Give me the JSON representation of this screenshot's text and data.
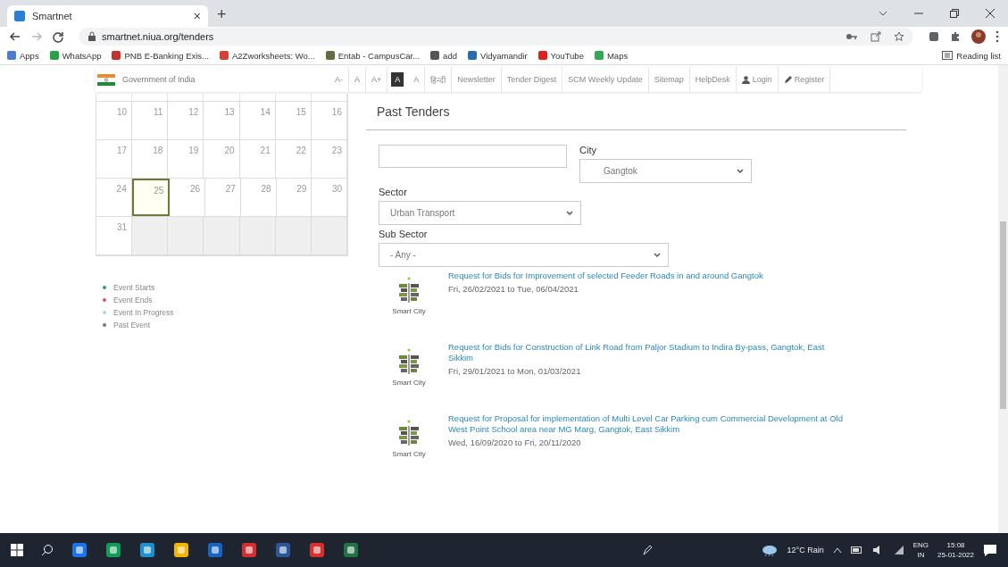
{
  "browser": {
    "tab": {
      "title": "Smartnet",
      "close": "×"
    },
    "new_tab": "+",
    "url": "smartnet.niua.org/tenders",
    "bookmarks": [
      {
        "label": "Apps",
        "color": "#4a7bd6"
      },
      {
        "label": "WhatsApp",
        "color": "#25a244"
      },
      {
        "label": "PNB E-Banking Exis...",
        "color": "#c8302c"
      },
      {
        "label": "A2Zworksheets: Wo...",
        "color": "#d8403a"
      },
      {
        "label": "Entab - CampusCar...",
        "color": "#6a6a40"
      },
      {
        "label": "add",
        "color": "#555555"
      },
      {
        "label": "Vidyamandir",
        "color": "#2a6cb0"
      },
      {
        "label": "YouTube",
        "color": "#e02020"
      },
      {
        "label": "Maps",
        "color": "#34a853"
      }
    ],
    "reading_list": "Reading list"
  },
  "topbar": {
    "org": "Government of India",
    "font_buttons": [
      {
        "label": "A-",
        "selected": false
      },
      {
        "label": "A",
        "selected": false
      },
      {
        "label": "A+",
        "selected": false
      },
      {
        "label": "A",
        "selected": true
      },
      {
        "label": "A",
        "selected": false
      }
    ],
    "links": [
      {
        "label": "हिन्दी",
        "kind": "text"
      },
      {
        "label": "Newsletter",
        "kind": "text"
      },
      {
        "label": "Tender Digest",
        "kind": "text"
      },
      {
        "label": "SCM Weekly Update",
        "kind": "text"
      },
      {
        "label": "Sitemap",
        "kind": "text"
      },
      {
        "label": "HelpDesk",
        "kind": "text"
      },
      {
        "label": "Login",
        "kind": "user"
      },
      {
        "label": "Register",
        "kind": "pencil"
      }
    ]
  },
  "calendar": {
    "weeks": [
      {
        "days": [
          {
            "day": "10",
            "today": false
          },
          {
            "day": "11",
            "today": false
          },
          {
            "day": "12",
            "today": false
          },
          {
            "day": "13",
            "today": false
          },
          {
            "day": "14",
            "today": false
          },
          {
            "day": "15",
            "today": false
          },
          {
            "day": "16",
            "today": false
          }
        ]
      },
      {
        "days": [
          {
            "day": "17",
            "today": false
          },
          {
            "day": "18",
            "today": false
          },
          {
            "day": "19",
            "today": false
          },
          {
            "day": "20",
            "today": false
          },
          {
            "day": "21",
            "today": false
          },
          {
            "day": "22",
            "today": false
          },
          {
            "day": "23",
            "today": false
          }
        ]
      },
      {
        "days": [
          {
            "day": "24",
            "today": false
          },
          {
            "day": "25",
            "today": true
          },
          {
            "day": "26",
            "today": false
          },
          {
            "day": "27",
            "today": false
          },
          {
            "day": "28",
            "today": false
          },
          {
            "day": "29",
            "today": false
          },
          {
            "day": "30",
            "today": false
          }
        ]
      },
      {
        "days": [
          {
            "day": "31",
            "today": false
          },
          {
            "outside": true
          },
          {
            "outside": true
          },
          {
            "outside": true
          },
          {
            "outside": true
          },
          {
            "outside": true
          },
          {
            "outside": true
          }
        ]
      }
    ],
    "legend": [
      {
        "label": "Event Starts",
        "color": "#2e9e6a"
      },
      {
        "label": "Event Ends",
        "color": "#e0505a"
      },
      {
        "label": "Event In Progress",
        "color": "#a8d8e8"
      },
      {
        "label": "Past Event",
        "color": "#777777"
      }
    ]
  },
  "content": {
    "title": "Past Tenders",
    "city_label": "City",
    "city": "Gangtok",
    "sector_label": "Sector",
    "sector": "Urban Transport",
    "subsector_label": "Sub Sector",
    "subsector": "- Any -",
    "tenders": [
      {
        "logo_label": "Smart City",
        "title": "Request for Bids for Improvement of selected Feeder Roads in and around Gangtok",
        "dates": "Fri, 26/02/2021 to Tue, 06/04/2021"
      },
      {
        "logo_label": "Smart City",
        "title": "Request for Bids for Construction of Link Road from Paljor Stadium to Indira By-pass, Gangtok, East Sikkim",
        "dates": "Fri, 29/01/2021 to Mon, 01/03/2021"
      },
      {
        "logo_label": "Smart City",
        "title": "Request for Proposal for implementation of Multi Level Car Parking cum Commercial Development at Old West Point School area near MG Marg, Gangtok, East Sikkim",
        "dates": "Wed, 16/09/2020 to Fri, 20/11/2020"
      }
    ]
  },
  "taskbar": {
    "weather": "12°C Rain",
    "lang": "ENG",
    "region": "IN",
    "time": "15:08",
    "date": "25-01-2022"
  }
}
